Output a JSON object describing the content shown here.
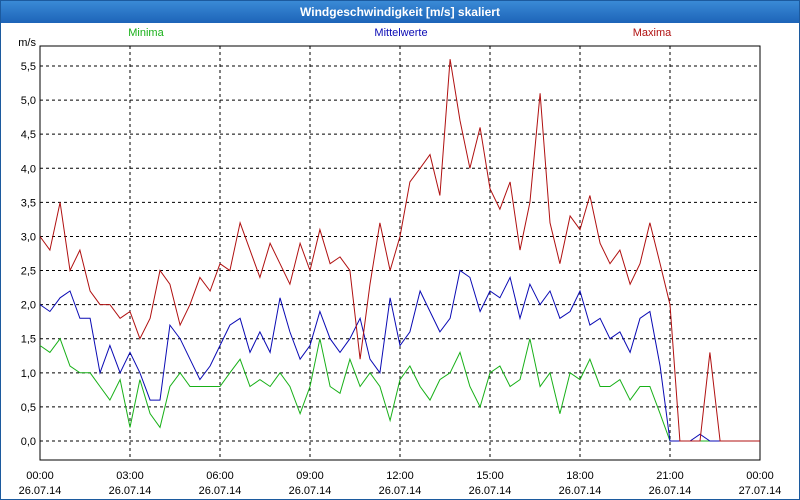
{
  "window": {
    "title": "Windgeschwindigkeit [m/s] skaliert"
  },
  "colors": {
    "Minima": "#18b018",
    "Mittelwerte": "#0a0ab4",
    "Maxima": "#b01010"
  },
  "chart_data": {
    "type": "line",
    "title": "Windgeschwindigkeit [m/s] skaliert",
    "ylabel": "m/s",
    "ylim": [
      0,
      5.5
    ],
    "y_ticks": [
      "0,0",
      "0,5",
      "1,0",
      "1,5",
      "2,0",
      "2,5",
      "3,0",
      "3,5",
      "4,0",
      "4,5",
      "5,0",
      "5,5"
    ],
    "x_ticks": [
      {
        "time": "00:00",
        "date": "26.07.14"
      },
      {
        "time": "03:00",
        "date": "26.07.14"
      },
      {
        "time": "06:00",
        "date": "26.07.14"
      },
      {
        "time": "09:00",
        "date": "26.07.14"
      },
      {
        "time": "12:00",
        "date": "26.07.14"
      },
      {
        "time": "15:00",
        "date": "26.07.14"
      },
      {
        "time": "18:00",
        "date": "26.07.14"
      },
      {
        "time": "21:00",
        "date": "26.07.14"
      },
      {
        "time": "00:00",
        "date": "27.07.14"
      }
    ],
    "x_start": "26.07.14 00:00",
    "x_end": "27.07.14 00:00",
    "grid": true,
    "legend_position": "top",
    "series": [
      {
        "name": "Minima",
        "x_hours": [
          0,
          0.33,
          0.67,
          1,
          1.33,
          1.67,
          2,
          2.33,
          2.67,
          3,
          3.33,
          3.67,
          4,
          4.33,
          4.67,
          5,
          5.33,
          5.67,
          6,
          6.33,
          6.67,
          7,
          7.33,
          7.67,
          8,
          8.33,
          8.67,
          9,
          9.33,
          9.67,
          10,
          10.33,
          10.67,
          11,
          11.33,
          11.67,
          12,
          12.33,
          12.67,
          13,
          13.33,
          13.67,
          14,
          14.33,
          14.67,
          15,
          15.33,
          15.67,
          16,
          16.33,
          16.67,
          17,
          17.33,
          17.67,
          18,
          18.33,
          18.67,
          19,
          19.33,
          19.67,
          20,
          20.33,
          20.67,
          21,
          21.33,
          21.67,
          22,
          22.33,
          22.67,
          23,
          23.33,
          23.67,
          24
        ],
        "values": [
          1.4,
          1.3,
          1.5,
          1.1,
          1.0,
          1.0,
          0.8,
          0.6,
          0.9,
          0.2,
          0.9,
          0.4,
          0.2,
          0.8,
          1.0,
          0.8,
          0.8,
          0.8,
          0.8,
          1.0,
          1.2,
          0.8,
          0.9,
          0.8,
          1.0,
          0.8,
          0.4,
          0.8,
          1.5,
          0.8,
          0.7,
          1.2,
          0.8,
          1.0,
          0.8,
          0.3,
          0.9,
          1.1,
          0.8,
          0.6,
          0.9,
          1.0,
          1.3,
          0.8,
          0.5,
          1.0,
          1.1,
          0.8,
          0.9,
          1.5,
          0.8,
          1.0,
          0.4,
          1.0,
          0.9,
          1.2,
          0.8,
          0.8,
          0.9,
          0.6,
          0.8,
          0.8,
          0.4,
          0.0,
          0.0,
          0.0,
          0.0,
          0.0,
          0.0,
          0.0,
          0.0,
          0.0,
          0.0
        ]
      },
      {
        "name": "Mittelwerte",
        "x_hours": [
          0,
          0.33,
          0.67,
          1,
          1.33,
          1.67,
          2,
          2.33,
          2.67,
          3,
          3.33,
          3.67,
          4,
          4.33,
          4.67,
          5,
          5.33,
          5.67,
          6,
          6.33,
          6.67,
          7,
          7.33,
          7.67,
          8,
          8.33,
          8.67,
          9,
          9.33,
          9.67,
          10,
          10.33,
          10.67,
          11,
          11.33,
          11.67,
          12,
          12.33,
          12.67,
          13,
          13.33,
          13.67,
          14,
          14.33,
          14.67,
          15,
          15.33,
          15.67,
          16,
          16.33,
          16.67,
          17,
          17.33,
          17.67,
          18,
          18.33,
          18.67,
          19,
          19.33,
          19.67,
          20,
          20.33,
          20.67,
          21,
          21.33,
          21.67,
          22,
          22.33,
          22.67,
          23,
          23.33,
          23.67,
          24
        ],
        "values": [
          2.0,
          1.9,
          2.1,
          2.2,
          1.8,
          1.8,
          1.0,
          1.4,
          1.0,
          1.3,
          1.0,
          0.6,
          0.6,
          1.7,
          1.5,
          1.2,
          0.9,
          1.1,
          1.4,
          1.7,
          1.8,
          1.3,
          1.6,
          1.3,
          2.1,
          1.6,
          1.2,
          1.4,
          1.9,
          1.5,
          1.3,
          1.5,
          1.8,
          1.2,
          1.0,
          2.1,
          1.4,
          1.6,
          2.2,
          1.9,
          1.6,
          1.8,
          2.5,
          2.4,
          1.9,
          2.2,
          2.1,
          2.4,
          1.8,
          2.3,
          2.0,
          2.2,
          1.8,
          1.9,
          2.2,
          1.7,
          1.8,
          1.5,
          1.6,
          1.3,
          1.8,
          1.9,
          1.1,
          0.0,
          0.0,
          0.0,
          0.1,
          0.0,
          0.0,
          0.0,
          0.0,
          0.0,
          0.0
        ]
      },
      {
        "name": "Maxima",
        "x_hours": [
          0,
          0.33,
          0.67,
          1,
          1.33,
          1.67,
          2,
          2.33,
          2.67,
          3,
          3.33,
          3.67,
          4,
          4.33,
          4.67,
          5,
          5.33,
          5.67,
          6,
          6.33,
          6.67,
          7,
          7.33,
          7.67,
          8,
          8.33,
          8.67,
          9,
          9.33,
          9.67,
          10,
          10.33,
          10.67,
          11,
          11.33,
          11.67,
          12,
          12.33,
          12.67,
          13,
          13.33,
          13.67,
          14,
          14.33,
          14.67,
          15,
          15.33,
          15.67,
          16,
          16.33,
          16.67,
          17,
          17.33,
          17.67,
          18,
          18.33,
          18.67,
          19,
          19.33,
          19.67,
          20,
          20.33,
          20.67,
          21,
          21.33,
          21.67,
          22,
          22.33,
          22.67,
          23,
          23.33,
          23.67,
          24
        ],
        "values": [
          3.0,
          2.8,
          3.5,
          2.5,
          2.8,
          2.2,
          2.0,
          2.0,
          1.8,
          1.9,
          1.5,
          1.8,
          2.5,
          2.3,
          1.7,
          2.0,
          2.4,
          2.2,
          2.6,
          2.5,
          3.2,
          2.8,
          2.4,
          2.9,
          2.6,
          2.3,
          2.9,
          2.5,
          3.1,
          2.6,
          2.7,
          2.5,
          1.2,
          2.3,
          3.2,
          2.5,
          3.0,
          3.8,
          4.0,
          4.2,
          3.6,
          5.6,
          4.7,
          4.0,
          4.6,
          3.7,
          3.4,
          3.8,
          2.8,
          3.5,
          5.1,
          3.2,
          2.6,
          3.3,
          3.1,
          3.6,
          2.9,
          2.6,
          2.8,
          2.3,
          2.6,
          3.2,
          2.6,
          2.0,
          0.0,
          0.0,
          0.0,
          1.3,
          0.0,
          0.0,
          0.0,
          0.0,
          0.0
        ]
      }
    ]
  }
}
